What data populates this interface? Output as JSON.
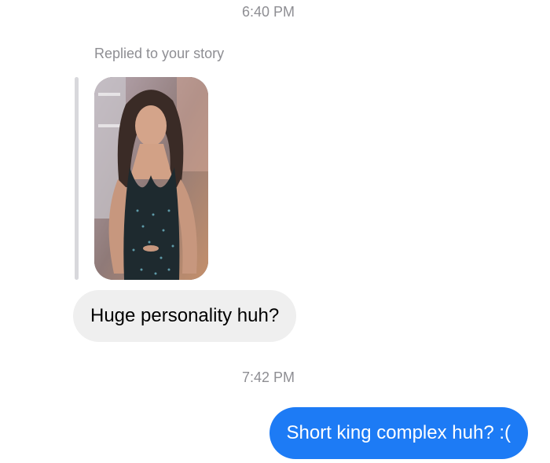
{
  "thread": {
    "timestamp_1": "6:40 PM",
    "story_reply": {
      "label": "Replied to your story",
      "thumbnail_icon": "story-photo-thumbnail"
    },
    "incoming_message": "Huge personality huh?",
    "timestamp_2": "7:42 PM",
    "outgoing_message": "Short king complex huh? :("
  },
  "colors": {
    "outgoing_bubble": "#1d7bf5",
    "incoming_bubble": "#efefef",
    "timestamp_text": "#8e8e93",
    "reply_bar": "#d8d8dc"
  }
}
